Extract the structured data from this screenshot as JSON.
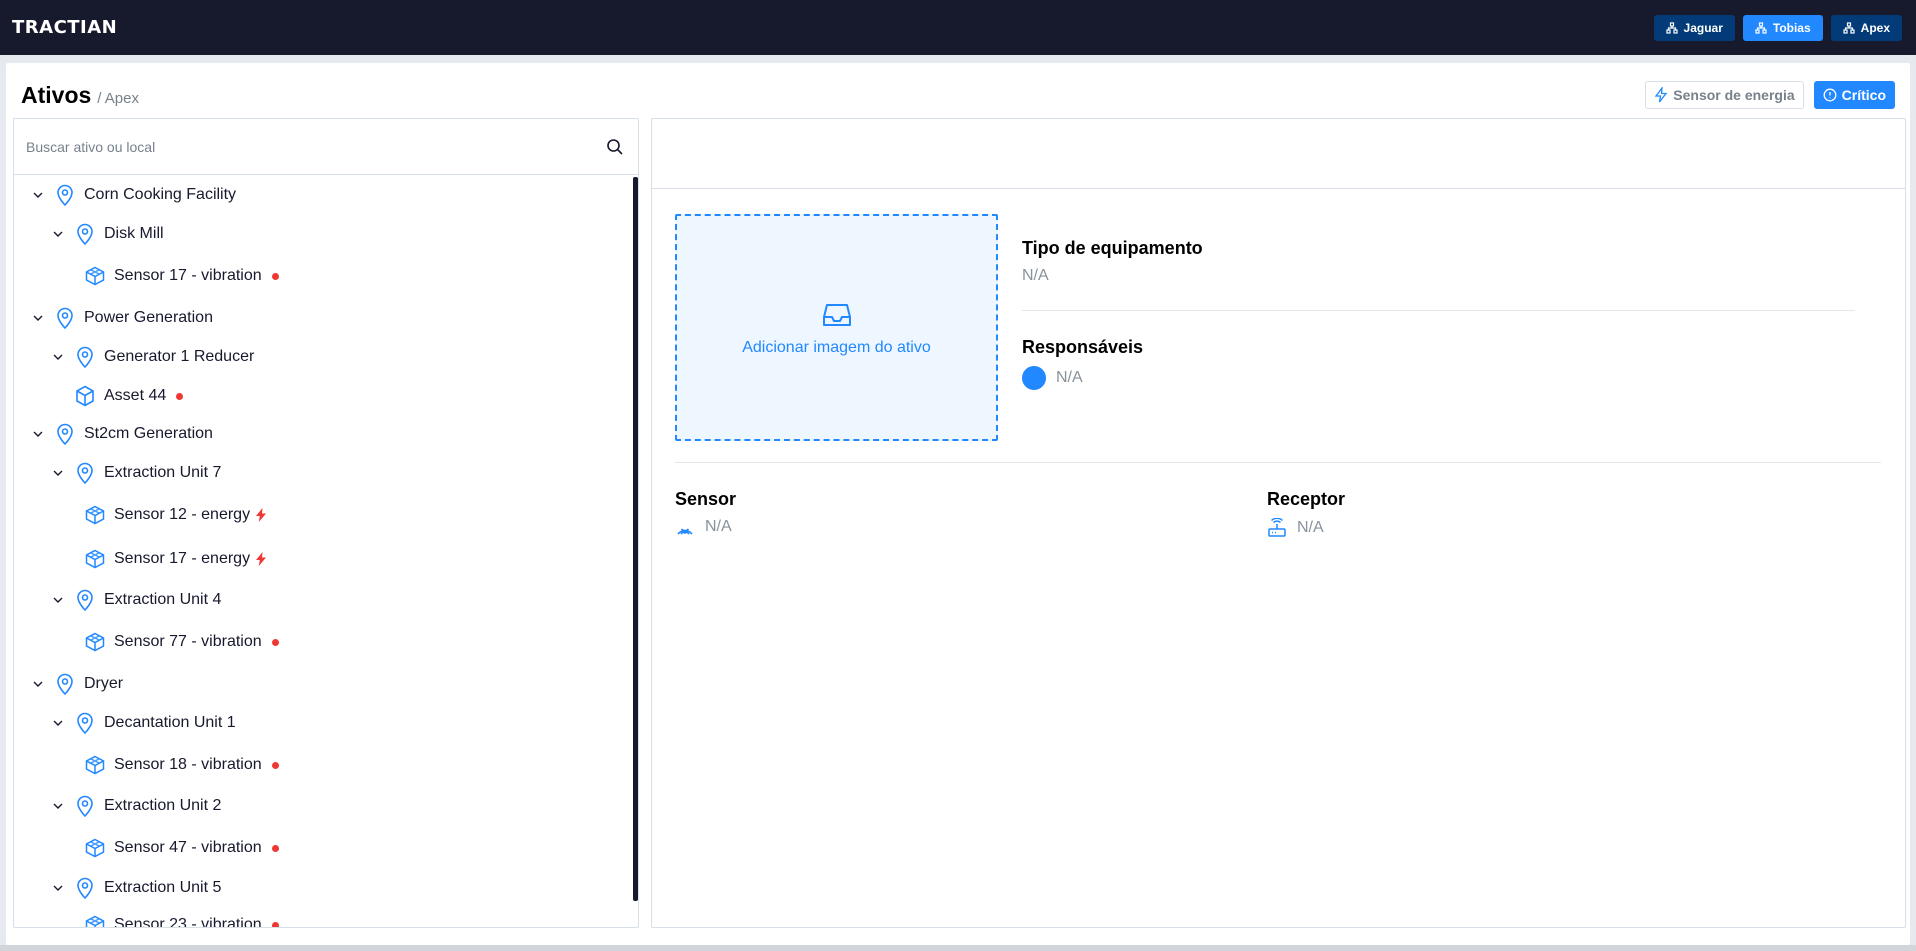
{
  "app": {
    "logo": "TRACTIAN",
    "companies": [
      {
        "label": "Jaguar",
        "active": false
      },
      {
        "label": "Tobias",
        "active": true
      },
      {
        "label": "Apex",
        "active": false
      }
    ]
  },
  "header": {
    "title": "Ativos",
    "breadcrumb": "/ Apex",
    "filters": {
      "energy": "Sensor de energia",
      "critical": "Crítico"
    }
  },
  "search": {
    "placeholder": "Buscar ativo ou local"
  },
  "tree": [
    {
      "label": "Corn Cooking Facility",
      "type": "location",
      "expanded": true,
      "level": 0
    },
    {
      "label": "Disk Mill",
      "type": "location",
      "expanded": true,
      "level": 1
    },
    {
      "label": "Sensor 17 - vibration",
      "type": "component",
      "status": "alert",
      "level": 2
    },
    {
      "label": "Power Generation",
      "type": "location",
      "expanded": true,
      "level": 0
    },
    {
      "label": "Generator 1 Reducer",
      "type": "location",
      "expanded": true,
      "level": 1
    },
    {
      "label": "Asset 44",
      "type": "asset",
      "status": "alert",
      "level": 2
    },
    {
      "label": "St2cm Generation",
      "type": "location",
      "expanded": true,
      "level": 0
    },
    {
      "label": "Extraction Unit 7",
      "type": "location",
      "expanded": true,
      "level": 1
    },
    {
      "label": "Sensor 12 - energy",
      "type": "component",
      "status": "energy",
      "level": 2
    },
    {
      "label": "Sensor 17 - energy",
      "type": "component",
      "status": "energy",
      "level": 2
    },
    {
      "label": "Extraction Unit 4",
      "type": "location",
      "expanded": true,
      "level": 1
    },
    {
      "label": "Sensor 77 - vibration",
      "type": "component",
      "status": "alert",
      "level": 2
    },
    {
      "label": "Dryer",
      "type": "location",
      "expanded": true,
      "level": 0
    },
    {
      "label": "Decantation Unit 1",
      "type": "location",
      "expanded": true,
      "level": 1
    },
    {
      "label": "Sensor 18 - vibration",
      "type": "component",
      "status": "alert",
      "level": 2
    },
    {
      "label": "Extraction Unit 2",
      "type": "location",
      "expanded": true,
      "level": 1
    },
    {
      "label": "Sensor 47 - vibration",
      "type": "component",
      "status": "alert",
      "level": 2
    },
    {
      "label": "Extraction Unit 5",
      "type": "location",
      "expanded": true,
      "level": 1
    },
    {
      "label": "Sensor 23 - vibration",
      "type": "component",
      "status": "alert",
      "level": 2
    }
  ],
  "detail": {
    "image_placeholder": "Adicionar imagem do ativo",
    "equipment_type_label": "Tipo de equipamento",
    "equipment_type_value": "N/A",
    "responsibles_label": "Responsáveis",
    "responsibles_value": "N/A",
    "sensor_label": "Sensor",
    "sensor_value": "N/A",
    "receiver_label": "Receptor",
    "receiver_value": "N/A"
  },
  "colors": {
    "brand_dark": "#17192d",
    "primary": "#2188ff",
    "alert": "#ed3833",
    "muted": "#88929c"
  }
}
